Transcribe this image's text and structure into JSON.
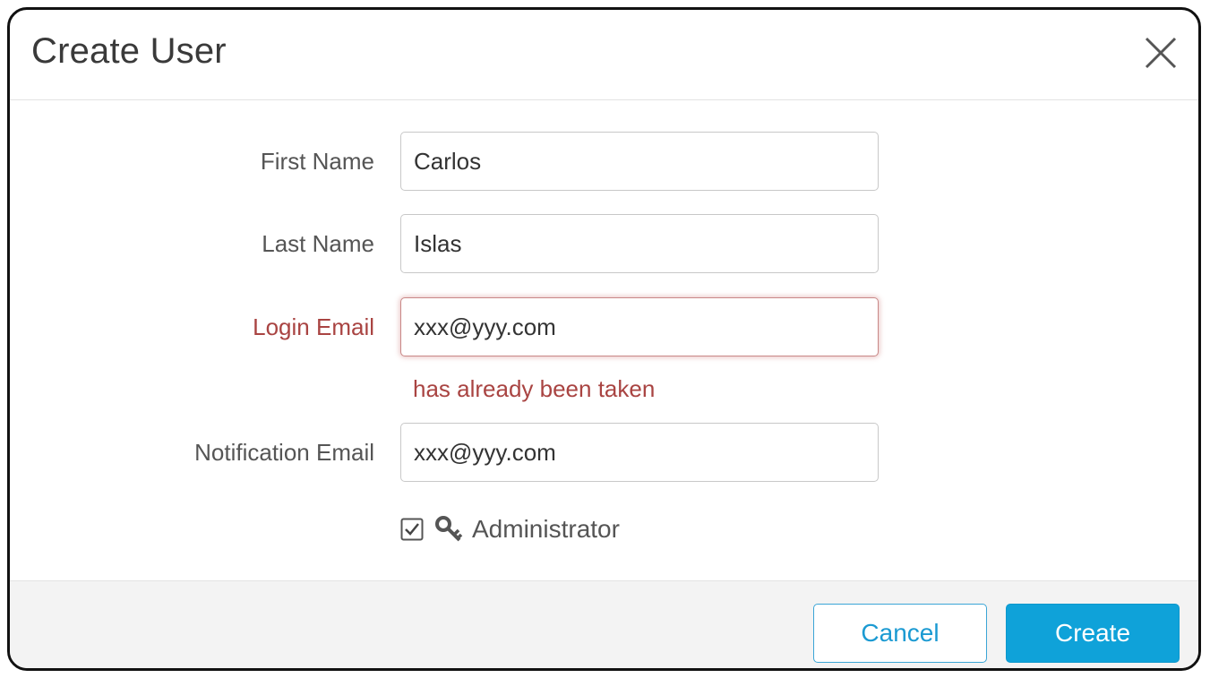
{
  "dialog": {
    "title": "Create User",
    "close_icon": "close-icon"
  },
  "form": {
    "first_name": {
      "label": "First Name",
      "value": "Carlos"
    },
    "last_name": {
      "label": "Last Name",
      "value": "Islas"
    },
    "login_email": {
      "label": "Login Email",
      "value": "xxx@yyy.com",
      "error": "has already been taken"
    },
    "notification_email": {
      "label": "Notification Email",
      "value": "xxx@yyy.com"
    },
    "administrator": {
      "label": "Administrator",
      "checked": true,
      "icon": "key-icon"
    }
  },
  "footer": {
    "cancel_label": "Cancel",
    "create_label": "Create"
  },
  "colors": {
    "error": "#a94442",
    "primary": "#0fa2d9",
    "footer_bg": "#f3f3f3"
  }
}
